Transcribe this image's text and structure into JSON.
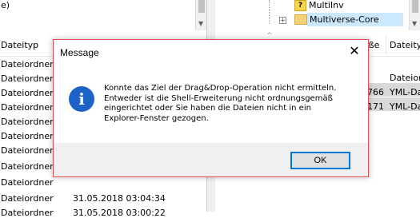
{
  "left_pane": {
    "top_text": "e)",
    "column_header": "Dateityp",
    "rows": [
      {
        "type": "Dateiordner",
        "date": ""
      },
      {
        "type": "Dateiordner",
        "date": ""
      },
      {
        "type": "Dateiordner",
        "date": ""
      },
      {
        "type": "Dateiordner",
        "date": ""
      },
      {
        "type": "Dateiordner",
        "date": ""
      },
      {
        "type": "Dateiordner",
        "date": ""
      },
      {
        "type": "Dateiordner",
        "date": ""
      },
      {
        "type": "Dateiordner",
        "date": ""
      },
      {
        "type": "Dateiordner",
        "date": ""
      },
      {
        "type": "Dateiordner",
        "date": "31.05.2018 03:04:34"
      },
      {
        "type": "Dateiordner",
        "date": "31.05.2018 03:00:22"
      }
    ]
  },
  "right_pane": {
    "tree_items": [
      "MultiInv",
      "Multiverse-Core"
    ],
    "expand_glyph": "+",
    "question_glyph": "?",
    "column_size_header": "öße",
    "column_type_header": "Dateity",
    "rows": [
      {
        "size": "",
        "type": "Dateior"
      },
      {
        "size": "766",
        "type": "YML-Da"
      },
      {
        "size": "171",
        "type": "YML-Da"
      }
    ]
  },
  "dialog": {
    "title": "Message",
    "close_glyph": "✕",
    "icon_glyph": "i",
    "message_lines": [
      "Konnte das Ziel der Drag&Drop-Operation nicht ermitteln.",
      "Entweder ist die Shell-Erweiterung nicht ordnungsgemäß",
      "eingerichtet oder Sie haben die Dateien nicht in ein",
      "Explorer-Fenster gezogen."
    ],
    "ok_label": "OK"
  },
  "colors": {
    "dialog_border": "#e0504f",
    "info_icon": "#1d63c7",
    "ok_border": "#0078d7",
    "tree_selection": "#cce8ff"
  }
}
